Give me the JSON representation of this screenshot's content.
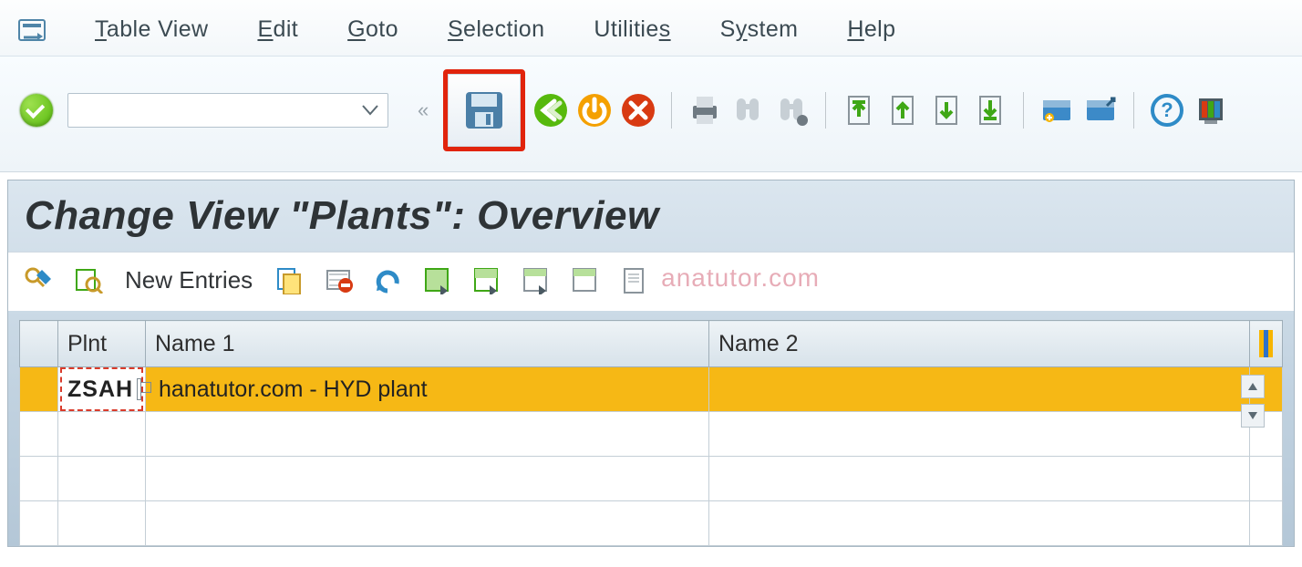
{
  "menu": {
    "items": [
      {
        "label": "Table View",
        "u": "T"
      },
      {
        "label": "Edit",
        "u": "E"
      },
      {
        "label": "Goto",
        "u": "G"
      },
      {
        "label": "Selection",
        "u": "S"
      },
      {
        "label": "Utilities",
        "u": "U",
        "upos": 7
      },
      {
        "label": "System",
        "u": "S",
        "upos": 2
      },
      {
        "label": "Help",
        "u": "H"
      }
    ]
  },
  "toolbar": {
    "command_value": "",
    "icons": [
      "save",
      "back",
      "exit",
      "cancel",
      "print",
      "find",
      "find-next",
      "first-page",
      "prev-page",
      "next-page",
      "last-page",
      "new-session",
      "shortcut",
      "help",
      "layout"
    ],
    "highlight": "save"
  },
  "view": {
    "title": "Change View \"Plants\": Overview"
  },
  "apptoolbar": {
    "new_entries_label": "New Entries",
    "icons": [
      "display-change",
      "details",
      "new-entries",
      "copy",
      "delete",
      "undo",
      "select-all",
      "select-block",
      "deselect",
      "table-settings",
      "print-preview"
    ]
  },
  "table": {
    "columns": [
      "Plnt",
      "Name 1",
      "Name 2"
    ],
    "rows": [
      {
        "plnt": "ZSAH",
        "name1": "hanatutor.com - HYD plant",
        "name2": "",
        "selected": true
      }
    ],
    "blank_rows": 3
  },
  "watermark": "anatutor.com",
  "colors": {
    "highlight_border": "#e1240c",
    "row_select": "#f6b815",
    "menu_text": "#3b4a52"
  }
}
